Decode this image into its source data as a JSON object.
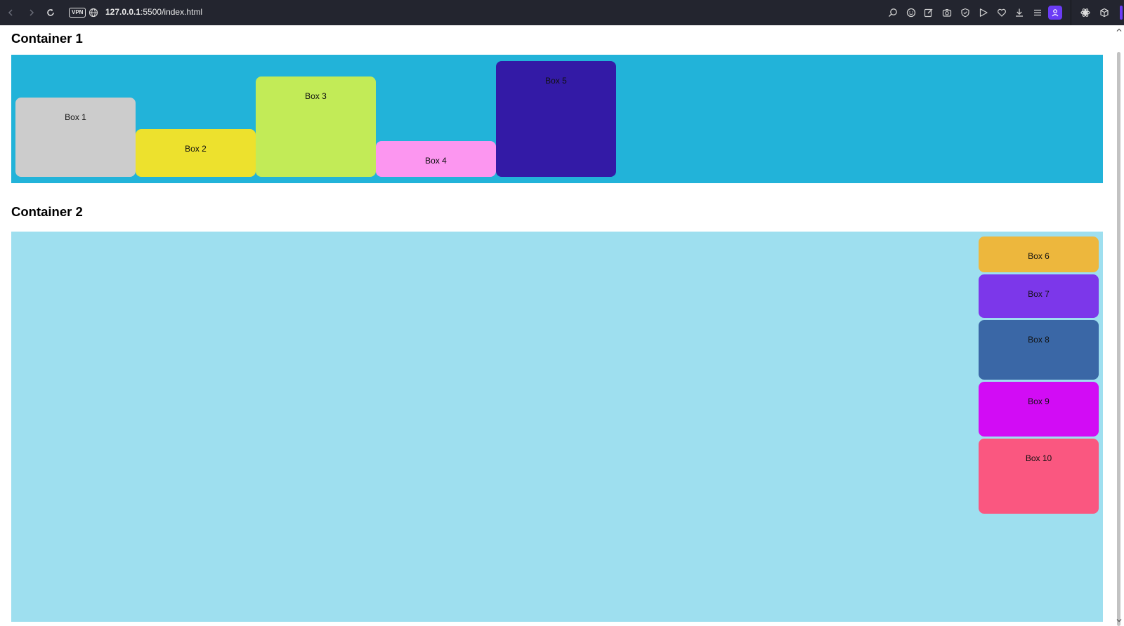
{
  "browser": {
    "url_host": "127.0.0.1",
    "url_rest": ":5500/index.html",
    "vpn_label": "VPN",
    "toolbar_icons": [
      "zoom-icon",
      "emoji-icon",
      "edit-icon",
      "camera-icon",
      "shield-icon",
      "send-icon",
      "heart-icon",
      "download-icon",
      "menu-icon"
    ],
    "accent_color": "#6b3cf5"
  },
  "container1": {
    "title": "Container 1",
    "bg_color": "#22b3d9",
    "boxes": [
      {
        "label": "Box 1",
        "color": "#cccccc"
      },
      {
        "label": "Box 2",
        "color": "#ede12d"
      },
      {
        "label": "Box 3",
        "color": "#c2eb57"
      },
      {
        "label": "Box 4",
        "color": "#fc96f0"
      },
      {
        "label": "Box 5",
        "color": "#331aa6"
      }
    ]
  },
  "container2": {
    "title": "Container 2",
    "bg_color": "#9edfef",
    "boxes": [
      {
        "label": "Box 6",
        "color": "#edb73d"
      },
      {
        "label": "Box 7",
        "color": "#7c37ea"
      },
      {
        "label": "Box 8",
        "color": "#3a67a6"
      },
      {
        "label": "Box 9",
        "color": "#d20cf5"
      },
      {
        "label": "Box 10",
        "color": "#fa5780"
      }
    ]
  }
}
